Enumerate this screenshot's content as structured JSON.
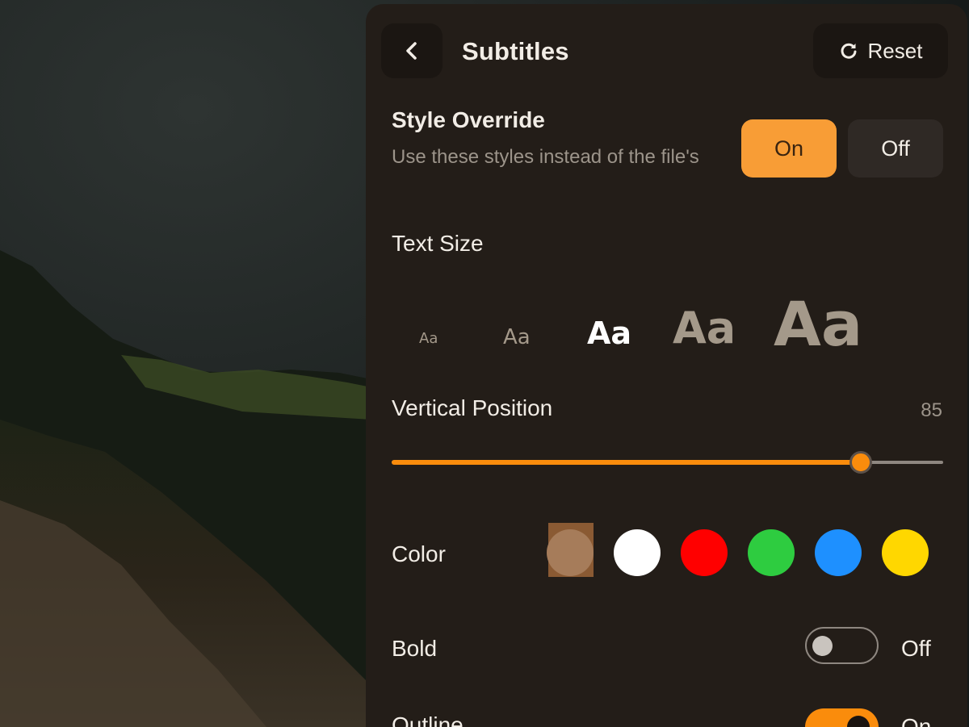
{
  "panel": {
    "title": "Subtitles",
    "back_icon": "chevron-left-icon",
    "reset": {
      "label": "Reset",
      "icon": "refresh-icon"
    }
  },
  "style_override": {
    "title": "Style Override",
    "description": "Use these styles instead of the file's",
    "on_label": "On",
    "off_label": "Off",
    "selected": "On"
  },
  "text_size": {
    "title": "Text Size",
    "options": [
      "Aa",
      "Aa",
      "Aa",
      "Aa",
      "Aa"
    ],
    "selected_index": 2
  },
  "vertical_position": {
    "title": "Vertical Position",
    "value": "85",
    "fraction": 0.85
  },
  "color": {
    "title": "Color",
    "swatches": [
      "#a67c5a",
      "#ffffff",
      "#ff0000",
      "#2ecc40",
      "#1e90ff",
      "#ffd700"
    ],
    "selected_index": 0
  },
  "bold": {
    "title": "Bold",
    "state": "Off"
  },
  "outline": {
    "title": "Outline",
    "state": "On"
  },
  "colors": {
    "accent": "#fa8c0c",
    "panel_bg": "#231d18"
  }
}
